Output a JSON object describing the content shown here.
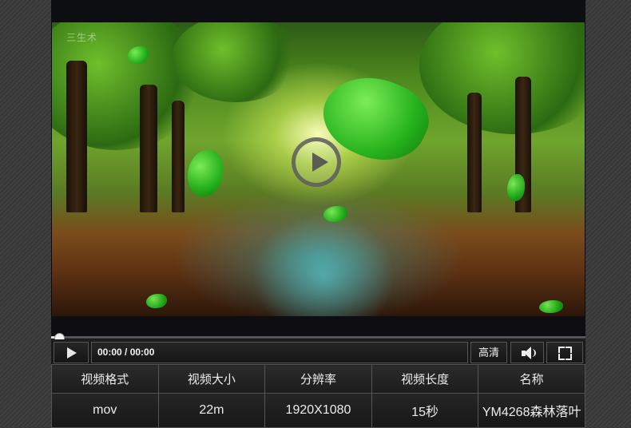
{
  "player": {
    "watermark": "三生术",
    "progress_fraction": 0.015,
    "time_display": "00:00 / 00:00",
    "quality_label": "高清",
    "icons": {
      "big_play": "play-circle-icon",
      "play": "play-icon",
      "volume": "volume-icon",
      "fullscreen": "fullscreen-icon"
    }
  },
  "info_table": {
    "headers": [
      "视频格式",
      "视频大小",
      "分辨率",
      "视频长度",
      "名称"
    ],
    "values": [
      "mov",
      "22m",
      "1920X1080",
      "15秒",
      "YM4268森林落叶"
    ]
  }
}
